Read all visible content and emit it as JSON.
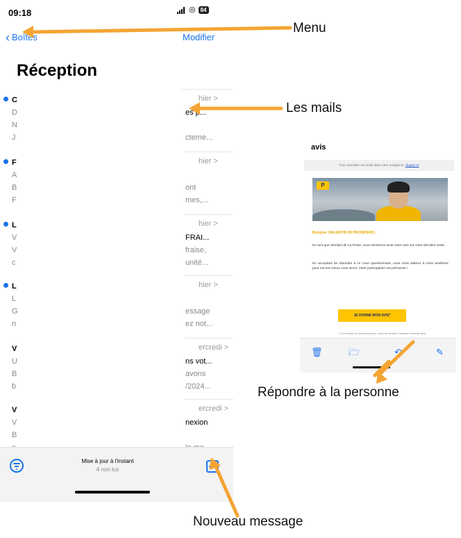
{
  "status_bar": {
    "time": "09:18",
    "battery": "84"
  },
  "nav": {
    "back_label": "Boîtes",
    "edit_label": "Modifier"
  },
  "inbox": {
    "title": "Réception",
    "mails": [
      {
        "unread": true,
        "date": "hier",
        "visible_left": [
          "C",
          "D",
          "N",
          "J"
        ],
        "visible_right": [
          "",
          "es p...",
          "",
          "cteme..."
        ]
      },
      {
        "unread": true,
        "date": "hier",
        "visible_left": [
          "F",
          "A",
          "B",
          "F"
        ],
        "visible_right": [
          "",
          "",
          "ont",
          "mes,..."
        ]
      },
      {
        "unread": true,
        "date": "hier",
        "visible_left": [
          "L",
          "V",
          "V",
          "c"
        ],
        "visible_right": [
          "",
          "FRAI...",
          "fraise,",
          "unité..."
        ]
      },
      {
        "unread": true,
        "date": "hier",
        "visible_left": [
          "L",
          "L",
          "G",
          "n"
        ],
        "visible_right": [
          "",
          "",
          "essage",
          "ez not..."
        ]
      },
      {
        "unread": false,
        "date": "ercredi",
        "visible_left": [
          "V",
          "U",
          "B",
          "b"
        ],
        "visible_right": [
          "",
          "ns vot...",
          "avons",
          "/2024..."
        ]
      },
      {
        "unread": false,
        "date": "ercredi",
        "visible_left": [
          "V",
          "V",
          "B",
          "c..."
        ],
        "visible_right": [
          "",
          "nexion",
          "",
          "le me..."
        ]
      }
    ]
  },
  "bottom_bar": {
    "update_text": "Mise à jour à l'instant",
    "unread_count": "4 non lus"
  },
  "annotations": {
    "menu": "Menu",
    "mails": "Les mails",
    "reply": "Répondre à la personne",
    "new_message": "Nouveau message"
  },
  "email_preview": {
    "subject": "avis",
    "web_notice": "Pour visualiser cet email dans votre navigateur,",
    "web_link": "cliquez ici",
    "logo_text": "P",
    "greeting": "Bonjour VALENTIN DI PROSPERO,",
    "paragraph_1": "En tant que client(e) de La Poste, nous aimerions avoir votre avis sur votre dernière visite.",
    "paragraph_2": "En acceptant de répondre à ce court questionnaire, vous nous aiderez à nous améliorer pour encore mieux vous servir. Votre participation est précieuse !",
    "cta": "JE DONNE MON AVIS*",
    "footnote": "* Si le bouton ne fonctionne pas, merci de recopier l'adresse suivante dans"
  },
  "colors": {
    "accent": "#1a73e8",
    "arrow": "#f4a433",
    "brand_yellow": "#ffc400",
    "brand_navy": "#1b2a6b"
  },
  "icons": {
    "back": "chevron-left-icon",
    "filter": "filter-icon",
    "compose": "compose-icon",
    "trash": "trash-icon",
    "folder": "folder-icon",
    "reply": "reply-icon"
  }
}
